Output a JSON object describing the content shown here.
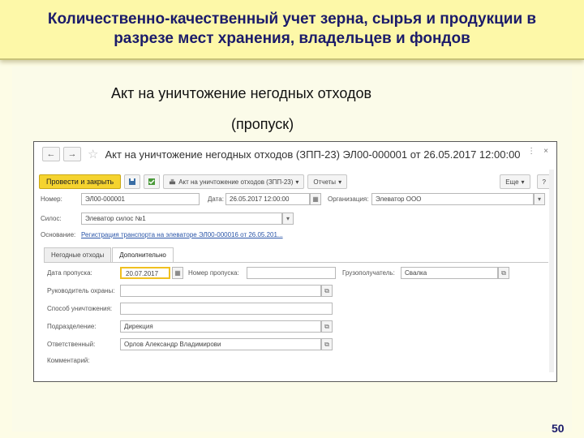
{
  "slide": {
    "title_line1": "Количественно-качественный учет зерна, сырья и продукции в",
    "title_line2": "разрезе мест хранения, владельцев и фондов",
    "heading": "Акт на уничтожение негодных отходов",
    "subheading": "(пропуск)",
    "page_number": "50"
  },
  "window": {
    "title": "Акт на уничтожение негодных отходов (ЗПП-23) ЭЛ00-000001 от 26.05.2017 12:00:00",
    "nav_back": "←",
    "nav_forward": "→",
    "star": "☆",
    "ctrl_more": "⋮",
    "ctrl_close": "×"
  },
  "toolbar": {
    "post_close": "Провести и закрыть",
    "print_label": "Акт на уничтожение отходов (ЗПП-23)",
    "reports": "Отчеты",
    "more": "Еще",
    "help": "?"
  },
  "header": {
    "number_label": "Номер:",
    "number_value": "ЭЛ00-000001",
    "date_label": "Дата:",
    "date_value": "26.05.2017 12:00:00",
    "org_label": "Организация:",
    "org_value": "Элеватор ООО",
    "silo_label": "Силос:",
    "silo_value": "Элеватор силос №1",
    "basis_label": "Основание:",
    "basis_value": "Регистрация транспорта на элеваторе ЭЛ00-000016 от 26.05.201..."
  },
  "tabs": [
    "Негодные отходы",
    "Дополнительно"
  ],
  "form": {
    "pass_date_label": "Дата пропуска:",
    "pass_date_value": "20.07.2017",
    "pass_number_label": "Номер пропуска:",
    "pass_number_value": "",
    "consignee_label": "Грузополучатель:",
    "consignee_value": "Свалка",
    "security_head_label": "Руководитель охраны:",
    "security_head_value": "",
    "destruction_method_label": "Способ уничтожения:",
    "destruction_method_value": "",
    "department_label": "Подразделение:",
    "department_value": "Дирекция",
    "responsible_label": "Ответственный:",
    "responsible_value": "Орлов Александр Владимирови",
    "comment_label": "Комментарий:",
    "comment_value": ""
  }
}
